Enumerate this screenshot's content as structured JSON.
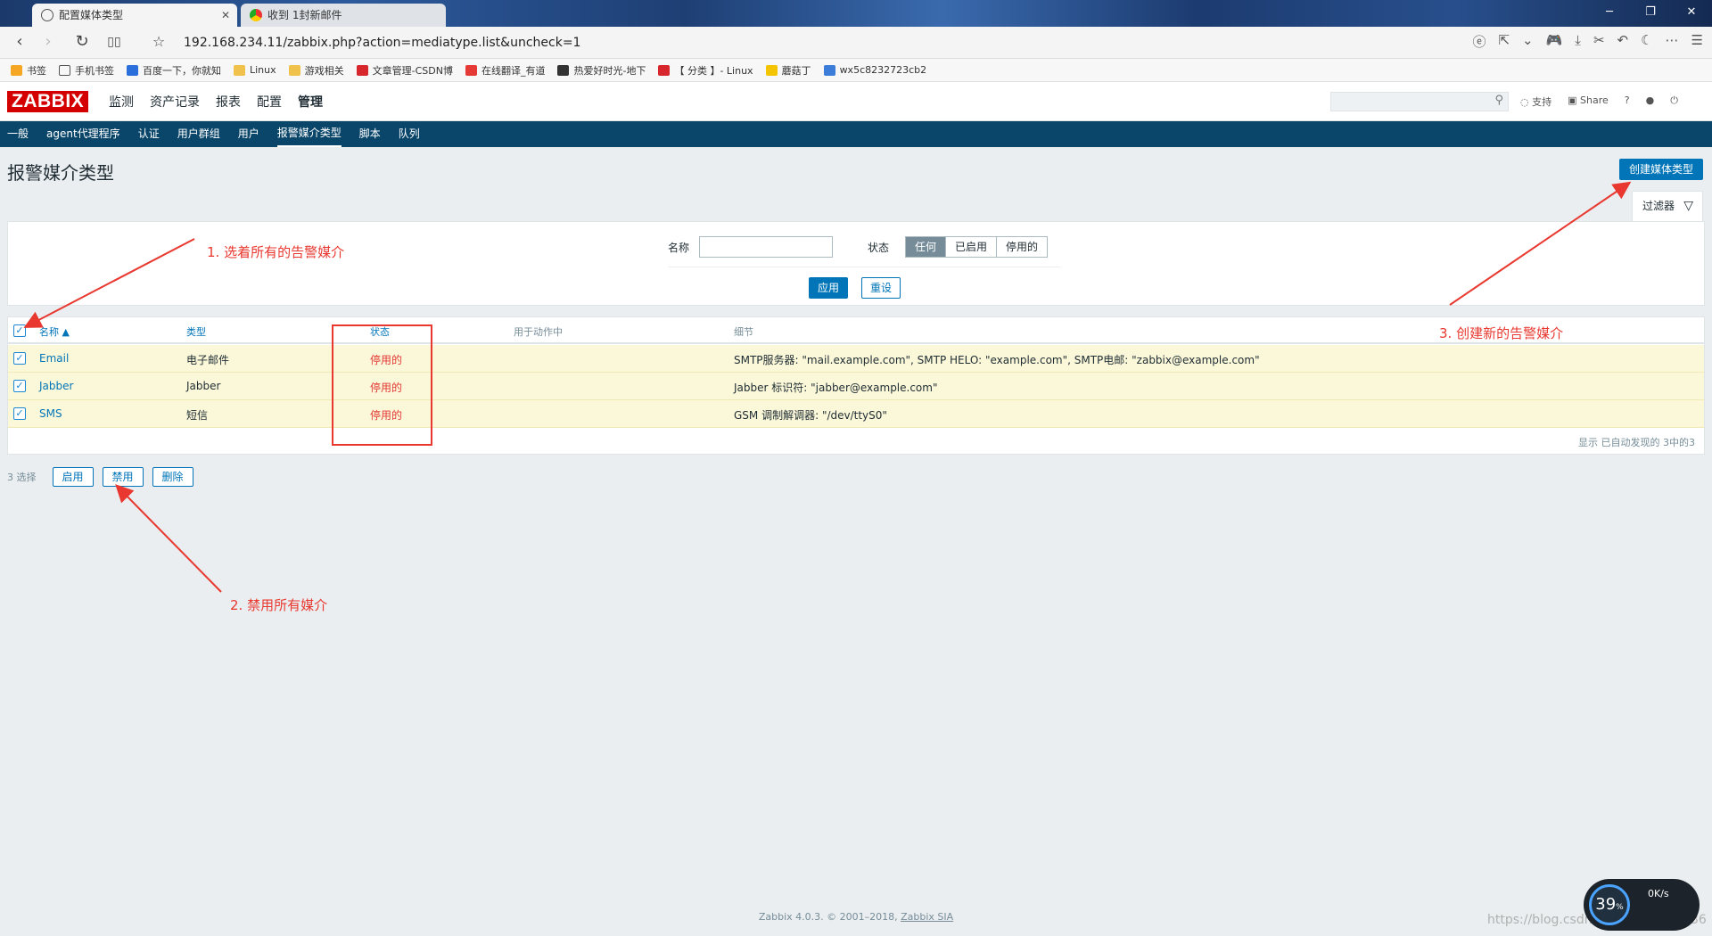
{
  "browser": {
    "tabs": [
      {
        "title": "配置媒体类型",
        "active": true
      },
      {
        "title": "收到 1封新邮件",
        "active": false
      }
    ],
    "url": "192.168.234.11/zabbix.php?action=mediatype.list&uncheck=1",
    "bookmarks": [
      "书签",
      "手机书签",
      "百度一下，你就知",
      "Linux",
      "游戏相关",
      "文章管理-CSDN博",
      "在线翻译_有道",
      "热爱好时光-地下",
      "【 分类 】- Linux",
      "蘑菇丁",
      "wx5c8232723cb2"
    ]
  },
  "zabbix": {
    "logo": "ZABBIX",
    "main_menu": [
      "监测",
      "资产记录",
      "报表",
      "配置",
      "管理"
    ],
    "main_menu_selected": "管理",
    "header_links": {
      "support": "支持",
      "share": "Share",
      "help": "?"
    },
    "sub_menu": [
      "一般",
      "agent代理程序",
      "认证",
      "用户群组",
      "用户",
      "报警媒介类型",
      "脚本",
      "队列"
    ],
    "sub_menu_selected": "报警媒介类型",
    "page_title": "报警媒介类型",
    "create_button": "创建媒体类型",
    "filter_tab": "过滤器",
    "filter": {
      "name_label": "名称",
      "name_value": "",
      "status_label": "状态",
      "status_options": [
        "任何",
        "已启用",
        "停用的"
      ],
      "status_selected": "任何",
      "apply": "应用",
      "reset": "重设"
    },
    "table": {
      "headers": {
        "name": "名称 ▲",
        "type": "类型",
        "status": "状态",
        "used_in_actions": "用于动作中",
        "details": "细节"
      },
      "rows": [
        {
          "name": "Email",
          "type": "电子邮件",
          "status": "停用的",
          "details": "SMTP服务器: \"mail.example.com\", SMTP HELO: \"example.com\", SMTP电邮: \"zabbix@example.com\""
        },
        {
          "name": "Jabber",
          "type": "Jabber",
          "status": "停用的",
          "details": "Jabber 标识符: \"jabber@example.com\""
        },
        {
          "name": "SMS",
          "type": "短信",
          "status": "停用的",
          "details": "GSM 调制解调器: \"/dev/ttyS0\""
        }
      ],
      "footer": "显示 已自动发现的 3中的3"
    },
    "bottom": {
      "selected": "3 选择",
      "enable": "启用",
      "disable": "禁用",
      "delete": "删除"
    },
    "footer": {
      "text": "Zabbix 4.0.3. © 2001–2018, ",
      "link": "Zabbix SIA"
    }
  },
  "annotations": {
    "a1": "1. 选着所有的告警媒介",
    "a2": "2. 禁用所有媒介",
    "a3": "3. 创建新的告警媒介",
    "color": "#e8382f"
  },
  "overlay": {
    "percent": "39",
    "percent_unit": "%",
    "rate": "0K/s",
    "watermark": "https://blog.csdn.net/qq_41882036"
  }
}
